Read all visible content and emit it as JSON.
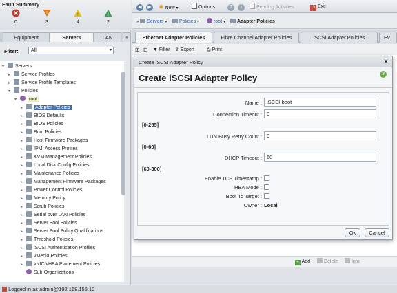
{
  "fault_summary": {
    "title": "Fault Summary",
    "items": [
      {
        "icon": "critical-icon",
        "count": "0",
        "color": "#c0392b"
      },
      {
        "icon": "major-icon",
        "count": "3",
        "color": "#e07b1a"
      },
      {
        "icon": "minor-icon",
        "count": "4",
        "color": "#e8c21c"
      },
      {
        "icon": "warning-icon",
        "count": "2",
        "color": "#3fa058"
      }
    ]
  },
  "left_tabs": [
    "Equipment",
    "Servers",
    "LAN"
  ],
  "filter": {
    "label": "Filter:",
    "value": "All"
  },
  "tree": [
    {
      "label": "Servers",
      "level": 0
    },
    {
      "label": "Service Profiles",
      "level": 1
    },
    {
      "label": "Service Profile Templates",
      "level": 1
    },
    {
      "label": "Policies",
      "level": 1
    },
    {
      "label": "root",
      "level": 2
    },
    {
      "label": "Adapter Policies",
      "level": 3,
      "selected": true
    },
    {
      "label": "BIOS Defaults",
      "level": 3
    },
    {
      "label": "BIOS Policies",
      "level": 3
    },
    {
      "label": "Boot Policies",
      "level": 3
    },
    {
      "label": "Host Firmware Packages",
      "level": 3
    },
    {
      "label": "IPMI Access Profiles",
      "level": 3
    },
    {
      "label": "KVM Management Policies",
      "level": 3
    },
    {
      "label": "Local Disk Config Policies",
      "level": 3
    },
    {
      "label": "Maintenance Policies",
      "level": 3
    },
    {
      "label": "Management Firmware Packages",
      "level": 3
    },
    {
      "label": "Power Control Policies",
      "level": 3
    },
    {
      "label": "Memory Policy",
      "level": 3
    },
    {
      "label": "Scrub Policies",
      "level": 3
    },
    {
      "label": "Serial over LAN Policies",
      "level": 3
    },
    {
      "label": "Server Pool Policies",
      "level": 3
    },
    {
      "label": "Server Pool Policy Qualifications",
      "level": 3
    },
    {
      "label": "Threshold Policies",
      "level": 3
    },
    {
      "label": "iSCSI Authentication Profiles",
      "level": 3
    },
    {
      "label": "vMedia Policies",
      "level": 3
    },
    {
      "label": "vNIC/vHBA Placement Policies",
      "level": 3
    },
    {
      "label": "Sub-Organizations",
      "level": 3
    }
  ],
  "toolbar": {
    "new_label": "New",
    "options_label": "Options",
    "pending_label": "Pending Activities",
    "exit_label": "Exit"
  },
  "breadcrumb": {
    "servers": "Servers",
    "policies": "Policies",
    "root": "root",
    "current": "Adapter Policies"
  },
  "right_tabs": [
    "Ethernet Adapter Policies",
    "Fibre Channel Adapter Policies",
    "iSCSI Adapter Policies",
    "Ev"
  ],
  "actions": {
    "filter": "Filter",
    "export": "Export",
    "print": "Print"
  },
  "bottom_actions": {
    "add": "Add",
    "delete": "Delete",
    "info": "Info"
  },
  "status": "Logged in as admin@192.168.155.10",
  "dialog": {
    "window_title": "Create iSCSI Adapter Policy",
    "heading": "Create iSCSI Adapter Policy",
    "help": "?",
    "close": "x",
    "fields": {
      "name_label": "Name :",
      "name_value": "iSCSI-boot",
      "conn_timeout_label": "Connection Timeout :",
      "conn_timeout_value": "0",
      "conn_timeout_range": "[0-255]",
      "lun_retry_label": "LUN Busy Retry Count :",
      "lun_retry_value": "0",
      "lun_retry_range": "[0-60]",
      "dhcp_timeout_label": "DHCP Timeout :",
      "dhcp_timeout_value": "60",
      "dhcp_timeout_range": "[60-300]",
      "tcp_timestamp_label": "Enable TCP Timestamp :",
      "hba_mode_label": "HBA Mode :",
      "boot_to_target_label": "Boot To Target :",
      "owner_label": "Owner :",
      "owner_value": "Local"
    },
    "ok_label": "Ok",
    "cancel_label": "Cancel"
  }
}
